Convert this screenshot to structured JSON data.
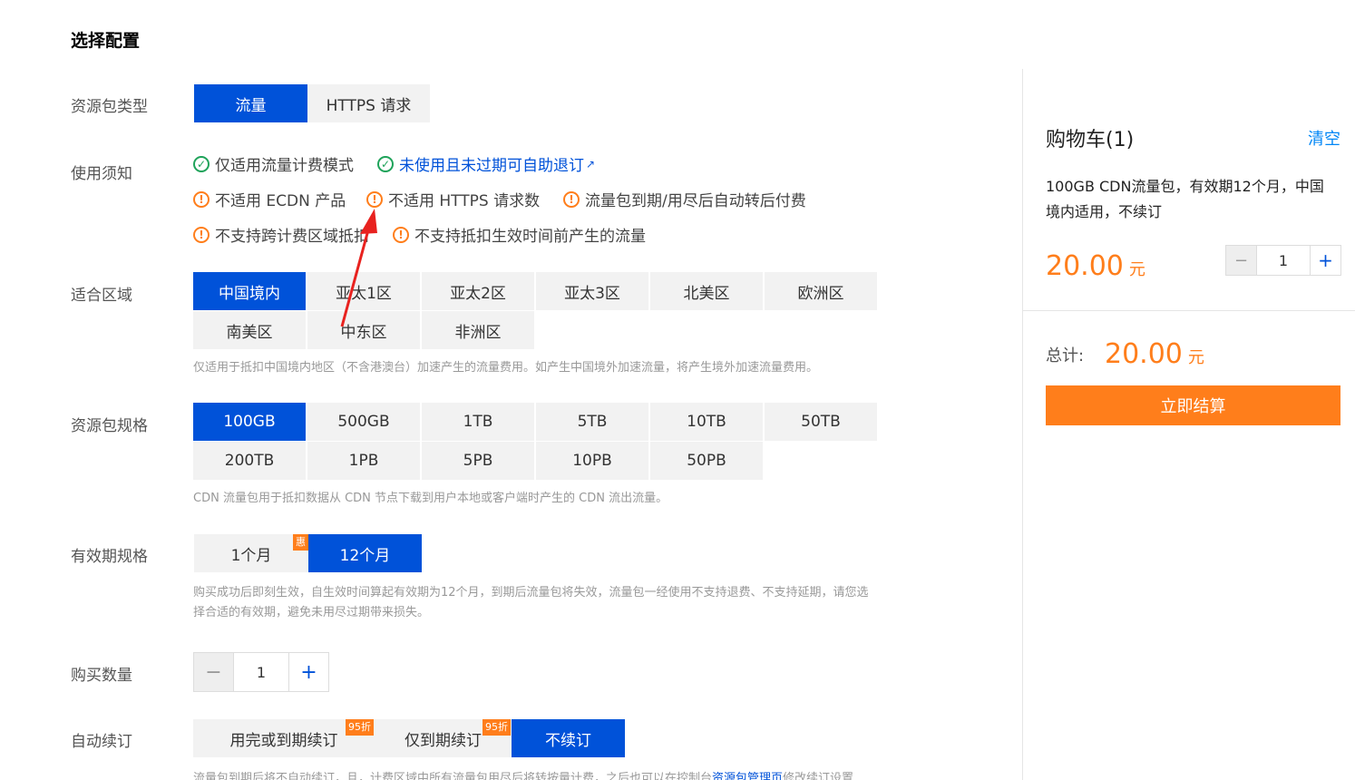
{
  "page_title": "选择配置",
  "labels": {
    "pkg_type": "资源包类型",
    "notice": "使用须知",
    "region": "适合区域",
    "spec": "资源包规格",
    "validity": "有效期规格",
    "qty": "购买数量",
    "renew": "自动续订"
  },
  "pkg_types": [
    "流量",
    "HTTPS 请求"
  ],
  "notices": {
    "ok1": "仅适用流量计费模式",
    "ok2": "未使用且未过期可自助退订",
    "w1": "不适用 ECDN 产品",
    "w2": "不适用 HTTPS 请求数",
    "w3": "流量包到期/用尽后自动转后付费",
    "w4": "不支持跨计费区域抵扣",
    "w5": "不支持抵扣生效时间前产生的流量"
  },
  "regions": [
    "中国境内",
    "亚太1区",
    "亚太2区",
    "亚太3区",
    "北美区",
    "欧洲区",
    "南美区",
    "中东区",
    "非洲区"
  ],
  "region_hint": "仅适用于抵扣中国境内地区（不含港澳台）加速产生的流量费用。如产生中国境外加速流量，将产生境外加速流量费用。",
  "specs": [
    "100GB",
    "500GB",
    "1TB",
    "5TB",
    "10TB",
    "50TB",
    "200TB",
    "1PB",
    "5PB",
    "10PB",
    "50PB"
  ],
  "spec_hint": "CDN 流量包用于抵扣数据从 CDN 节点下载到用户本地或客户端时产生的 CDN 流出流量。",
  "validity": [
    "1个月",
    "12个月"
  ],
  "validity_badge": "惠",
  "validity_hint1": "购买成功后即刻生效，自生效时间算起有效期为12个月，到期后流量包将失效，流量包一经使用不支持退费、不支持延期，请您选",
  "validity_hint2": "择合适的有效期，避免未用尽过期带来损失。",
  "quantity": "1",
  "renew_opts": [
    "用完或到期续订",
    "仅到期续订",
    "不续订"
  ],
  "renew_badge": "95折",
  "renew_hint_pre": "流量包到期后将不自动续订，且，计费区域中所有流量包用尽后将转按量计费，之后也可以在控制台",
  "renew_hint_link": "资源包管理页",
  "renew_hint_post": "修改续订设置",
  "cart": {
    "title": "购物车(1)",
    "clear": "清空",
    "desc": "100GB CDN流量包，有效期12个月，中国境内适用，不续订",
    "price": "20.00",
    "unit": "元",
    "qty": "1",
    "total_label": "总计:",
    "total": "20.00",
    "checkout": "立即结算"
  },
  "colors": {
    "primary": "#0052d9",
    "accent": "#ff7e1b",
    "ok": "#1fa35a"
  }
}
